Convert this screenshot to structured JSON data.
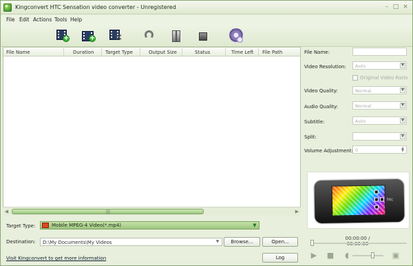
{
  "window": {
    "title": "Kingconvert HTC Sensation video converter - Unregistered"
  },
  "menu": [
    "File",
    "Edit",
    "Actions",
    "Tools",
    "Help"
  ],
  "toolbar": {
    "icons": [
      "add-video-icon",
      "add-folder-icon",
      "remove-video-icon",
      "undo-icon",
      "pause-icon",
      "stop-icon",
      "settings-gear-icon"
    ]
  },
  "table": {
    "headers": [
      "File Name",
      "Duration",
      "Target Type",
      "Output Size",
      "Status",
      "Time Left",
      "File Path"
    ]
  },
  "properties": {
    "file_name_label": "File Name:",
    "video_resolution_label": "Video Resolution:",
    "video_resolution_value": "Auto",
    "original_ratio_label": "Original Video Ratio",
    "video_quality_label": "Video Quality:",
    "video_quality_value": "Normal",
    "audio_quality_label": "Audio Quality:",
    "audio_quality_value": "Normal",
    "subtitle_label": "Subtitle:",
    "subtitle_value": "Auto",
    "split_label": "Split:",
    "volume_label": "Volume Adjustment:",
    "volume_value": "0"
  },
  "preview": {
    "device_brand": "htc",
    "time": "00:00:00 / 00:00:00"
  },
  "bottom": {
    "target_type_label": "Target Type:",
    "target_type_value": "Mobile MPEG-4 Video(*.mp4)",
    "destination_label": "Destination:",
    "destination_value": "D:\\My Documents\\My Videos",
    "browse_button": "Browse...",
    "open_button": "Open...",
    "log_button": "Log",
    "website_link": "Visit Kingconvert to get more information"
  },
  "colors": {
    "window_background": "#e8efdc",
    "accent_green": "#9dc57f",
    "border_green": "#8aa774"
  }
}
